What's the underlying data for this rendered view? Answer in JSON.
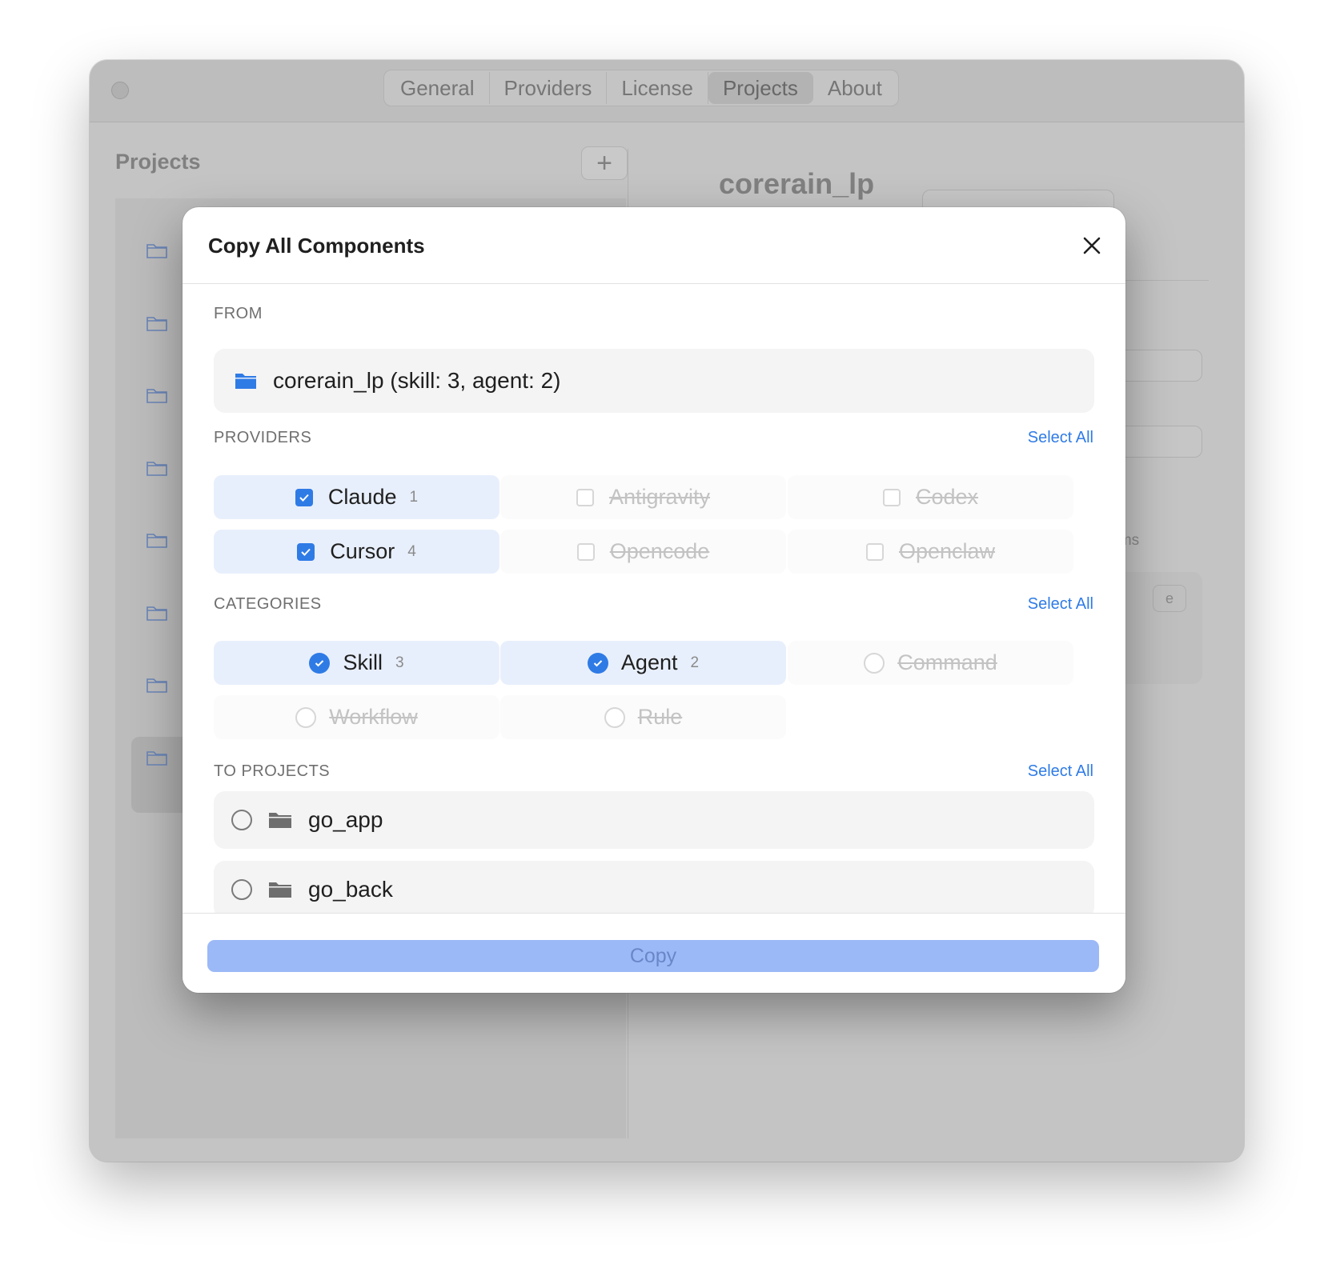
{
  "window": {
    "tabs": [
      {
        "label": "General"
      },
      {
        "label": "Providers"
      },
      {
        "label": "License"
      },
      {
        "label": "Projects"
      },
      {
        "label": "About"
      }
    ],
    "active_tab": "Projects",
    "sidebar": {
      "title": "Projects",
      "add_icon": "plus-icon"
    },
    "detail": {
      "title": "corerain_lp",
      "partial_text": "tems",
      "partial_button": "e"
    }
  },
  "modal": {
    "title": "Copy All Components",
    "close_icon": "close-icon",
    "from": {
      "label": "FROM",
      "source": "corerain_lp (skill: 3, agent: 2)",
      "icon": "folder-icon"
    },
    "providers": {
      "label": "PROVIDERS",
      "select_all": "Select All",
      "items": [
        {
          "label": "Claude",
          "count": "1",
          "checked": true
        },
        {
          "label": "Antigravity",
          "count": "",
          "checked": false
        },
        {
          "label": "Codex",
          "count": "",
          "checked": false
        },
        {
          "label": "Cursor",
          "count": "4",
          "checked": true
        },
        {
          "label": "Opencode",
          "count": "",
          "checked": false
        },
        {
          "label": "Openclaw",
          "count": "",
          "checked": false
        }
      ]
    },
    "categories": {
      "label": "CATEGORIES",
      "select_all": "Select All",
      "items": [
        {
          "label": "Skill",
          "count": "3",
          "checked": true
        },
        {
          "label": "Agent",
          "count": "2",
          "checked": true
        },
        {
          "label": "Command",
          "count": "",
          "checked": false
        },
        {
          "label": "Workflow",
          "count": "",
          "checked": false
        },
        {
          "label": "Rule",
          "count": "",
          "checked": false
        }
      ]
    },
    "to_projects": {
      "label": "TO PROJECTS",
      "select_all": "Select All",
      "items": [
        {
          "name": "go_app",
          "selected": false
        },
        {
          "name": "go_back",
          "selected": false
        }
      ]
    },
    "copy_button": "Copy"
  },
  "colors": {
    "accent": "#2f7be6",
    "chip_selected_bg": "#e8effc",
    "copy_disabled_bg": "#9cb9f7"
  }
}
